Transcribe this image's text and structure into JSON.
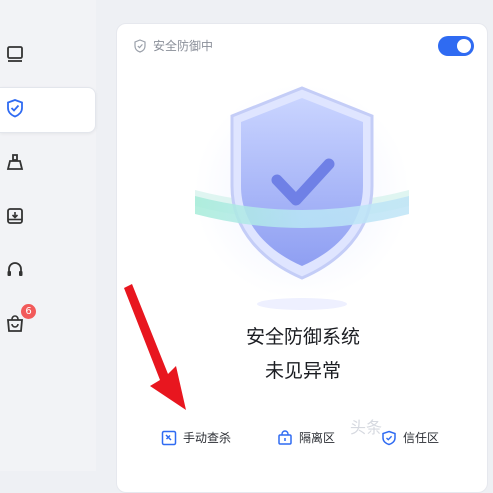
{
  "status": {
    "label": "安全防御中"
  },
  "headline": {
    "line1": "安全防御系统",
    "line2": "未见异常"
  },
  "actions": [
    {
      "label": "手动查杀",
      "icon": "scan-icon"
    },
    {
      "label": "隔离区",
      "icon": "quarantine-box-icon"
    },
    {
      "label": "信任区",
      "icon": "trust-shield-icon"
    }
  ],
  "sidebar": {
    "items": [
      {
        "icon": "monitor-icon"
      },
      {
        "icon": "shield-check-icon"
      },
      {
        "icon": "broom-icon"
      },
      {
        "icon": "download-drive-icon"
      },
      {
        "icon": "headset-icon"
      },
      {
        "icon": "shopping-bag-icon",
        "badge": "6"
      }
    ]
  },
  "watermark": {
    "text": "头条"
  },
  "colors": {
    "accent": "#2f6bf2",
    "arrow": "#e8161f",
    "badge": "#f25a5a"
  }
}
